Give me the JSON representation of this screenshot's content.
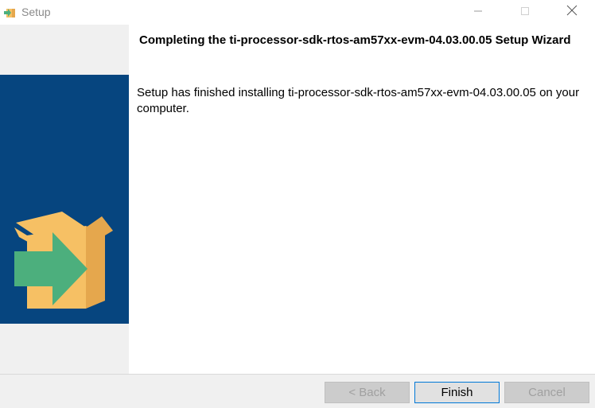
{
  "window": {
    "title": "Setup",
    "icon": "installer-icon"
  },
  "controls": {
    "minimize_icon": "minimize-icon",
    "maximize_icon": "maximize-icon",
    "close_icon": "close-icon"
  },
  "content": {
    "heading": "Completing the ti-processor-sdk-rtos-am57xx-evm-04.03.00.05 Setup Wizard",
    "message": "Setup has finished installing ti-processor-sdk-rtos-am57xx-evm-04.03.00.05 on your computer."
  },
  "buttons": {
    "back_label": "< Back",
    "back_enabled": false,
    "finish_label": "Finish",
    "finish_enabled": true,
    "cancel_label": "Cancel",
    "cancel_enabled": false
  },
  "colors": {
    "banner": "#06457f",
    "box": "#f6c064",
    "box_shade": "#e5a74d",
    "arrow": "#4caf7d",
    "focus": "#0078d7"
  }
}
